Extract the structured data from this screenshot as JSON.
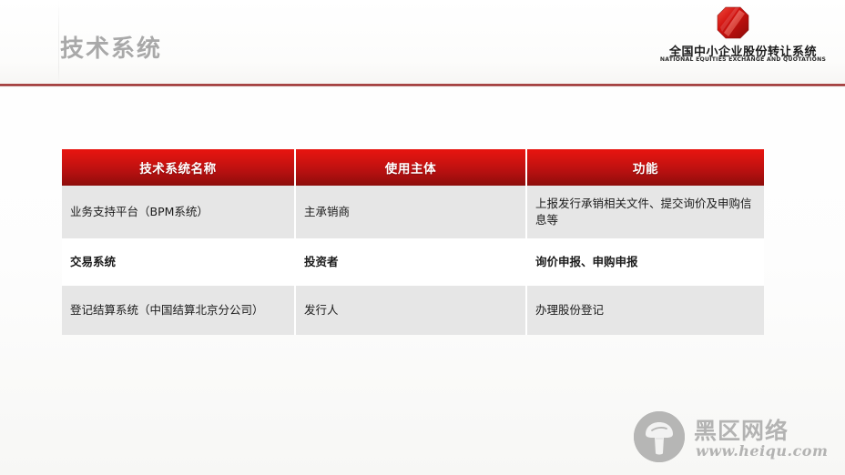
{
  "header": {
    "title": "技术系统",
    "rule_color": "#8b1717",
    "title_color": "#a9a9a9"
  },
  "logo": {
    "mark_icon": "neeq-octagon-logo-icon",
    "name_cn": "全国中小企业股份转让系统",
    "name_en": "NATIONAL EQUITIES EXCHANGE AND QUOTATIONS",
    "accent_color": "#cc1111"
  },
  "table": {
    "header_color": "#c41410",
    "shade_color": "#e6e6e6",
    "columns": [
      "技术系统名称",
      "使用主体",
      "功能"
    ],
    "rows": [
      {
        "style": "shade",
        "bold": false,
        "cells": [
          "业务支持平台（BPM系统）",
          "主承销商",
          "上报发行承销相关文件、提交询价及申购信息等"
        ]
      },
      {
        "style": "plain",
        "bold": true,
        "cells": [
          "交易系统",
          "投资者",
          "询价申报、申购申报"
        ]
      },
      {
        "style": "shade",
        "bold": false,
        "cells": [
          "登记结算系统（中国结算北京分公司）",
          "发行人",
          "办理股份登记"
        ]
      }
    ]
  },
  "watermark": {
    "icon": "mushroom-icon",
    "text": "黑区网络",
    "url": "www.heiqu.com",
    "color": "#8a8a8a"
  }
}
